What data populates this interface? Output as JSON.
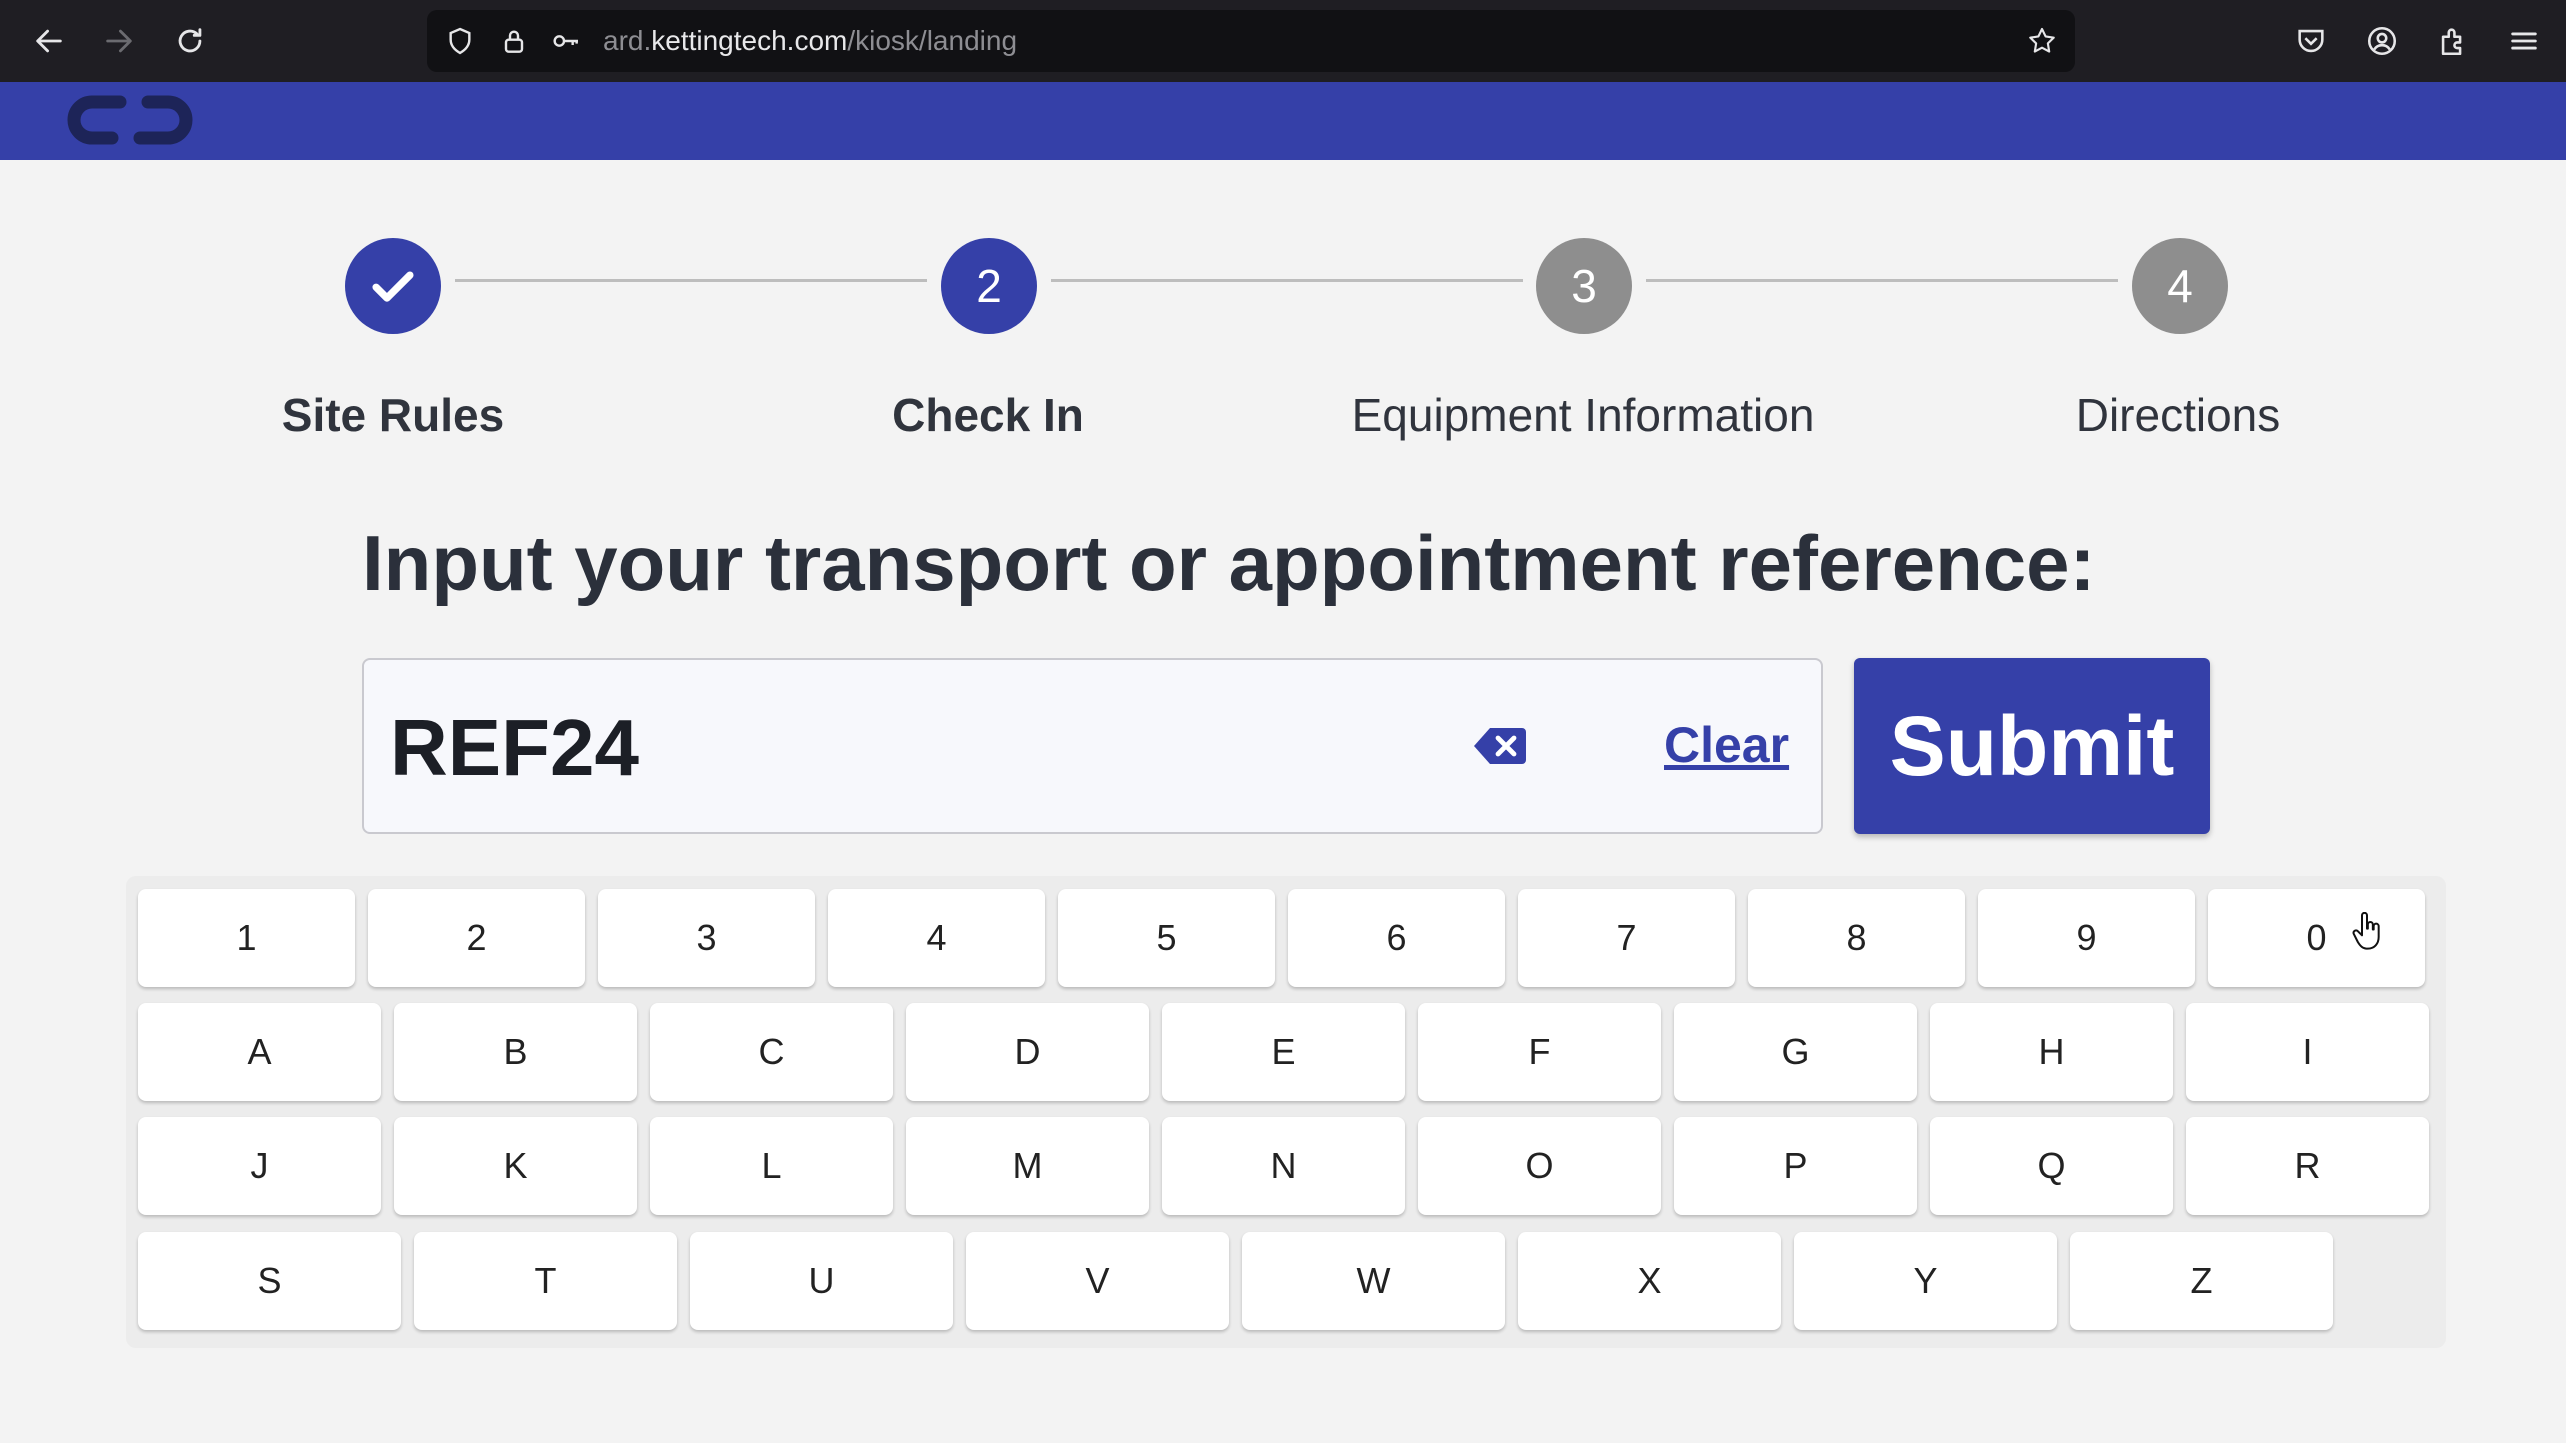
{
  "browser": {
    "url_prefix": "ard.",
    "url_host": "kettingtech.com",
    "url_path": "/kiosk/landing"
  },
  "colors": {
    "brand": "#3540a8",
    "pending_step": "#8e8e8e",
    "browser_bar": "#1f1e23"
  },
  "stepper": {
    "steps": [
      {
        "number": "",
        "label": "Site Rules",
        "state": "done"
      },
      {
        "number": "2",
        "label": "Check In",
        "state": "active"
      },
      {
        "number": "3",
        "label": "Equipment Information",
        "state": "pending"
      },
      {
        "number": "4",
        "label": "Directions",
        "state": "pending"
      }
    ]
  },
  "main": {
    "heading": "Input your transport or appointment reference:",
    "reference_value": "REF24",
    "clear_label": "Clear",
    "submit_label": "Submit"
  },
  "keyboard": {
    "rows": [
      [
        "1",
        "2",
        "3",
        "4",
        "5",
        "6",
        "7",
        "8",
        "9",
        "0"
      ],
      [
        "A",
        "B",
        "C",
        "D",
        "E",
        "F",
        "G",
        "H",
        "I"
      ],
      [
        "J",
        "K",
        "L",
        "M",
        "N",
        "O",
        "P",
        "Q",
        "R"
      ],
      [
        "S",
        "T",
        "U",
        "V",
        "W",
        "X",
        "Y",
        "Z"
      ]
    ]
  }
}
